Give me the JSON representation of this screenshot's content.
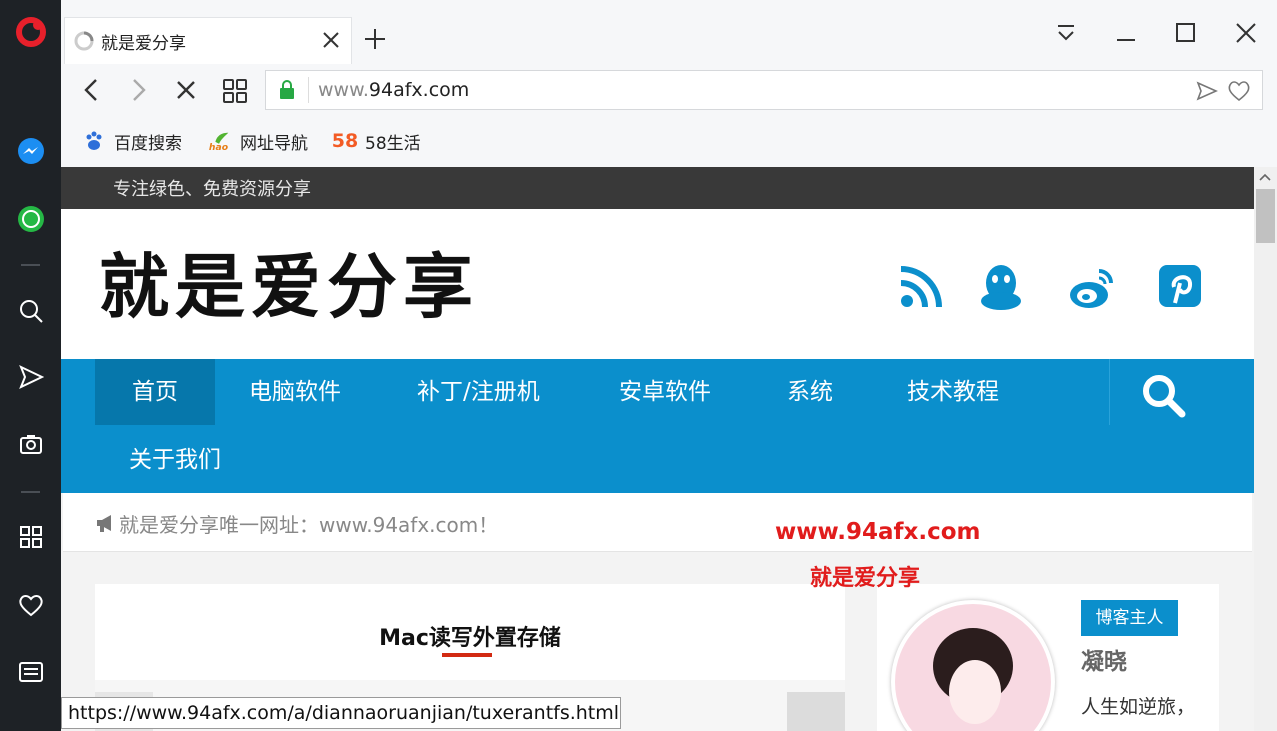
{
  "tab": {
    "title": "就是爱分享"
  },
  "address": {
    "url_prefix": "www.",
    "url_domain": "94afx.com"
  },
  "bookmarks": [
    {
      "label": "百度搜索"
    },
    {
      "label": "网址导航"
    },
    {
      "label": "58生活",
      "icon_text": "58"
    }
  ],
  "site": {
    "tagline": "专注绿色、免费资源分享",
    "logo": "就是爱分享",
    "nav": [
      "首页",
      "电脑软件",
      "补丁/注册机",
      "安卓软件",
      "系统",
      "技术教程",
      "关于我们"
    ],
    "notice": "就是爱分享唯一网址：www.94afx.com！",
    "watermark_url": "www.94afx.com",
    "watermark_name": "就是爱分享",
    "article_title": "Mac读写外置存储",
    "aside": {
      "badge": "博客主人",
      "author": "凝晓",
      "motto": "人生如逆旅，"
    },
    "accent": "#0b8fcc"
  },
  "statusbar": {
    "link": "https://www.94afx.com/a/diannaoruanjian/tuxerantfs.html"
  }
}
